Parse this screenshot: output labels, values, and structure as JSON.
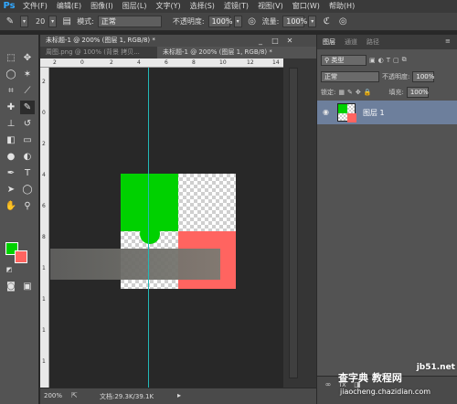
{
  "app": {
    "logo": "Ps"
  },
  "menubar": {
    "items": [
      "文件(F)",
      "编辑(E)",
      "图像(I)",
      "图层(L)",
      "文字(Y)",
      "选择(S)",
      "滤镜(T)",
      "视图(V)",
      "窗口(W)",
      "帮助(H)"
    ]
  },
  "options": {
    "brush_size": "20",
    "mode_label": "模式:",
    "mode_value": "正常",
    "opacity_label": "不透明度:",
    "opacity_value": "100%",
    "flow_label": "流量:",
    "flow_value": "100%"
  },
  "tabs": {
    "active": "未标题-1 @ 200% (图层 1, RGB/8) *",
    "inactive_1": "周图.png @ 100% (背景 拷贝...",
    "inactive_2": "未标题-1 @ 200% (图层 1, RGB/8) *"
  },
  "ruler": {
    "top": [
      "2",
      "0",
      "2",
      "4",
      "6",
      "8",
      "10",
      "12",
      "14"
    ],
    "left": [
      "2",
      "0",
      "2",
      "4",
      "6",
      "8",
      "1",
      "1",
      "1",
      "1"
    ]
  },
  "colors": {
    "foreground": "#00d100",
    "background": "#ff6460",
    "guide": "#23b8b8"
  },
  "status": {
    "zoom": "200%",
    "doc": "文档:29.3K/39.1K"
  },
  "layers_panel": {
    "tabs": [
      "图层",
      "通道",
      "路径"
    ],
    "kind_label": "类型",
    "blend_mode": "正常",
    "opacity_label": "不透明度:",
    "opacity_value": "100%",
    "lock_label": "锁定:",
    "fill_label": "填充:",
    "fill_value": "100%",
    "layers": [
      {
        "name": "图层 1"
      }
    ]
  },
  "watermark": {
    "main": "查字典 教程网",
    "domain": "jb51.net",
    "sub": "jiaocheng.chazidian.com"
  }
}
